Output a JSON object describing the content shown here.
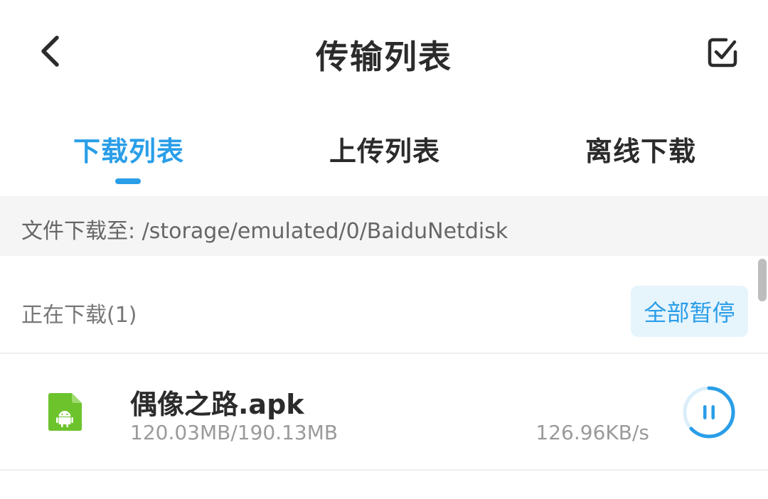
{
  "header": {
    "title": "传输列表",
    "back_icon": "chevron-left-icon",
    "select_icon": "checkbox-icon"
  },
  "tabs": [
    {
      "label": "下载列表",
      "active": true
    },
    {
      "label": "上传列表",
      "active": false
    },
    {
      "label": "离线下载",
      "active": false
    }
  ],
  "path_bar": {
    "text": "文件下载至: /storage/emulated/0/BaiduNetdisk"
  },
  "downloading": {
    "title": "正在下载(1)",
    "pause_all_label": "全部暂停"
  },
  "items": [
    {
      "name": "偶像之路.apk",
      "size_text": "120.03MB/190.13MB",
      "speed": "126.96KB/s",
      "progress": 0.631,
      "file_type_icon": "android-apk-icon",
      "action_icon": "pause-icon"
    }
  ],
  "colors": {
    "accent": "#2a9ee8",
    "android_green": "#6cc32c"
  }
}
